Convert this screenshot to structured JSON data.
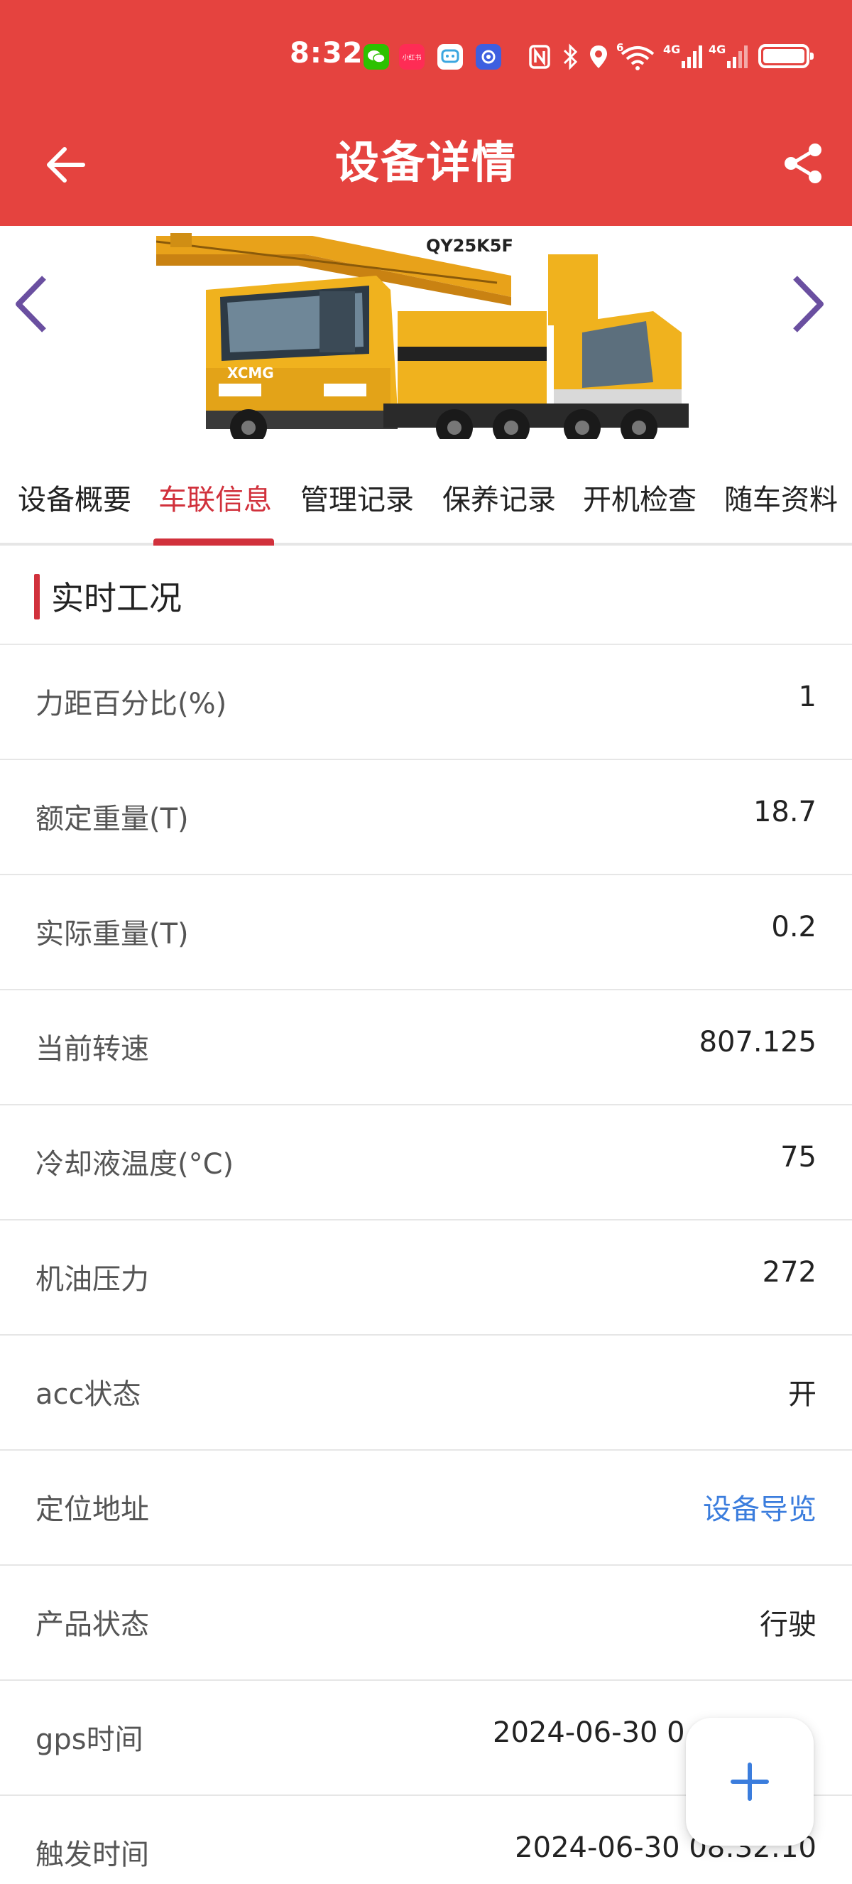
{
  "status_bar": {
    "time": "8:32",
    "badge_xiaohongshu": "小红书",
    "net_4g_1": "4G",
    "net_4g_2": "4G",
    "wifi_6": "6"
  },
  "header": {
    "title": "设备详情"
  },
  "carousel": {
    "model_text": "QY25K5F",
    "brand_text": "XCMG"
  },
  "tabs": [
    {
      "label": "设备概要"
    },
    {
      "label": "车联信息"
    },
    {
      "label": "管理记录"
    },
    {
      "label": "保养记录"
    },
    {
      "label": "开机检查"
    },
    {
      "label": "随车资料"
    }
  ],
  "active_tab_index": 1,
  "section": {
    "title": "实时工况"
  },
  "rows": [
    {
      "label": "力距百分比(%)",
      "value": "1"
    },
    {
      "label": "额定重量(T)",
      "value": "18.7"
    },
    {
      "label": "实际重量(T)",
      "value": "0.2"
    },
    {
      "label": "当前转速",
      "value": "807.125"
    },
    {
      "label": "冷却液温度(°C)",
      "value": "75"
    },
    {
      "label": "机油压力",
      "value": "272"
    },
    {
      "label": "acc状态",
      "value": "开"
    },
    {
      "label": "定位地址",
      "value": "设备导览"
    },
    {
      "label": "产品状态",
      "value": "行驶"
    },
    {
      "label": "gps时间",
      "value": "2024-06-30 0"
    },
    {
      "label": "触发时间",
      "value": "2024-06-30 08:32:10"
    }
  ],
  "colors": {
    "brand_red": "#E5433F",
    "accent_red": "#D1313C",
    "link_blue": "#3B7DDD",
    "arrow_purple": "#6A4FA0"
  }
}
